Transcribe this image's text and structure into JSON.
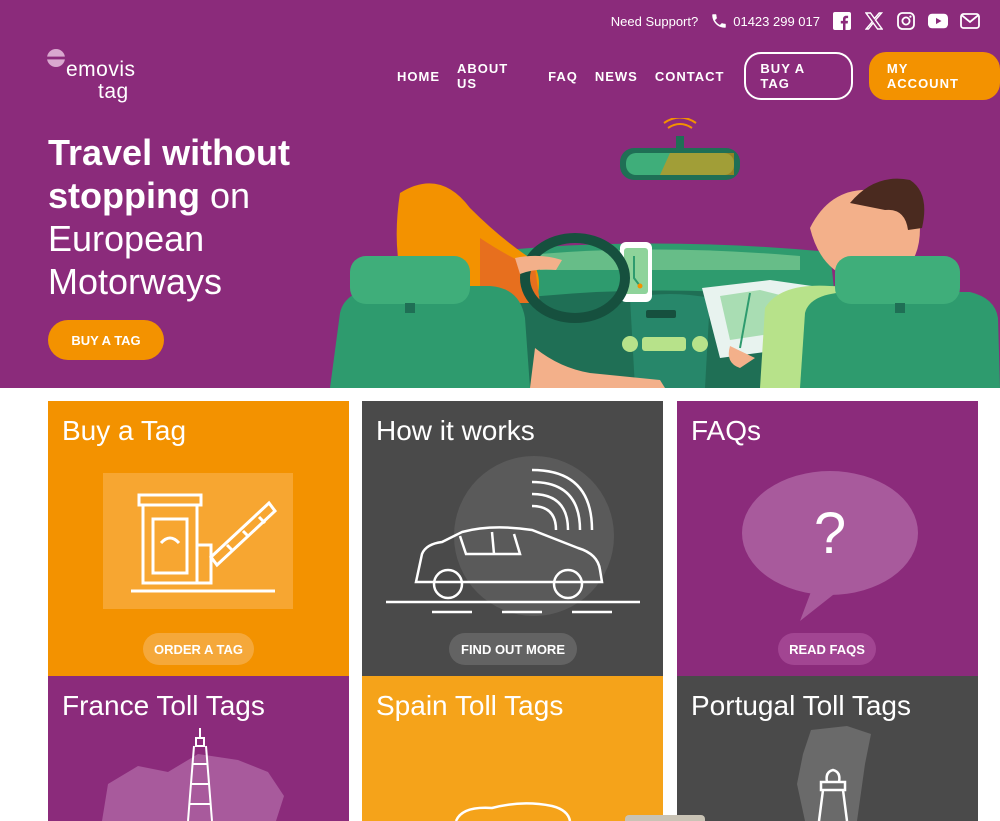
{
  "topbar": {
    "support_label": "Need Support?",
    "phone": "01423 299 017",
    "social_icons": [
      "facebook-icon",
      "x-icon",
      "instagram-icon",
      "youtube-icon",
      "mail-icon"
    ]
  },
  "brand": {
    "line1": "emovis",
    "line2": "tag"
  },
  "nav": {
    "items": [
      "HOME",
      "ABOUT US",
      "FAQ",
      "NEWS",
      "CONTACT"
    ],
    "buy_tag": "BUY A TAG",
    "my_account": "MY ACCOUNT"
  },
  "hero": {
    "title_bold_1": "Travel without",
    "title_bold_2": "stopping",
    "title_rest_2": " on",
    "title_line3": "European",
    "title_line4": "Motorways",
    "cta": "BUY A TAG"
  },
  "cards": [
    {
      "title": "Buy a Tag",
      "button": "ORDER A TAG",
      "color": "#f39200"
    },
    {
      "title": "How it works",
      "button": "FIND OUT MORE",
      "color": "#4a4a4a"
    },
    {
      "title": "FAQs",
      "button": "READ FAQS",
      "color": "#8b2b7b"
    },
    {
      "title": "France Toll Tags",
      "color": "#8b2b7b"
    },
    {
      "title": "Spain Toll Tags",
      "color": "#f5a31a"
    },
    {
      "title": "Portugal Toll Tags",
      "color": "#4a4a4a"
    }
  ],
  "colors": {
    "purple": "#8b2b7b",
    "orange": "#f39200",
    "dark": "#4a4a4a",
    "green": "#2e9b6e"
  }
}
